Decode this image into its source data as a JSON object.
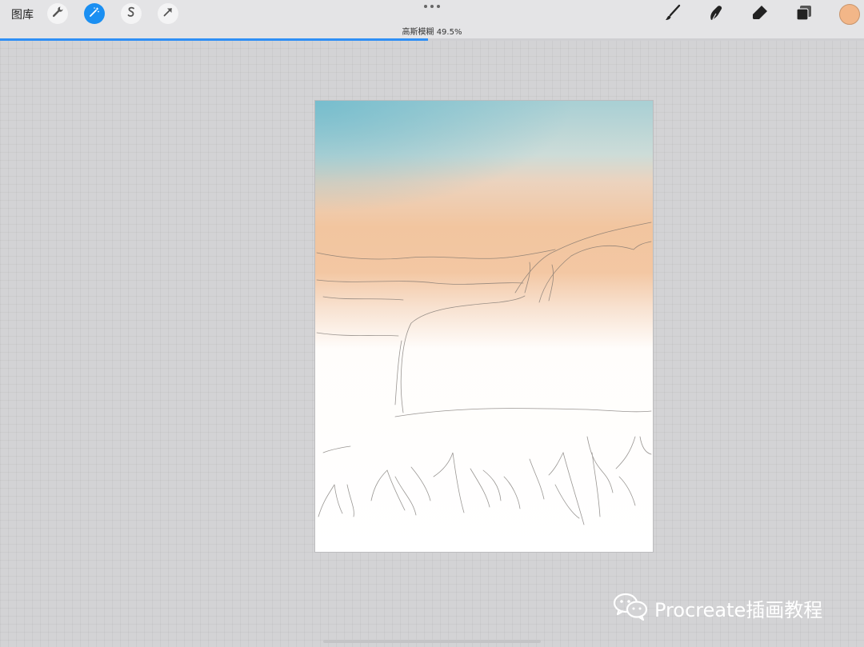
{
  "toolbar": {
    "gallery_label": "图库",
    "left_tools": [
      {
        "name": "wrench-icon",
        "active": false
      },
      {
        "name": "magic-wand-icon",
        "active": true
      },
      {
        "name": "selection-s-icon",
        "active": false
      },
      {
        "name": "transform-arrow-icon",
        "active": false
      }
    ],
    "right_tools": [
      "brush-icon",
      "smudge-icon",
      "eraser-icon",
      "layers-icon"
    ],
    "current_color": "#f2b688",
    "accent_color": "#1a8ff2"
  },
  "status": {
    "adjustment_label": "高斯模糊 49.5%",
    "progress_percent": 49.5
  },
  "watermark": {
    "text": "Procreate插画教程",
    "icon": "wechat-icon"
  }
}
